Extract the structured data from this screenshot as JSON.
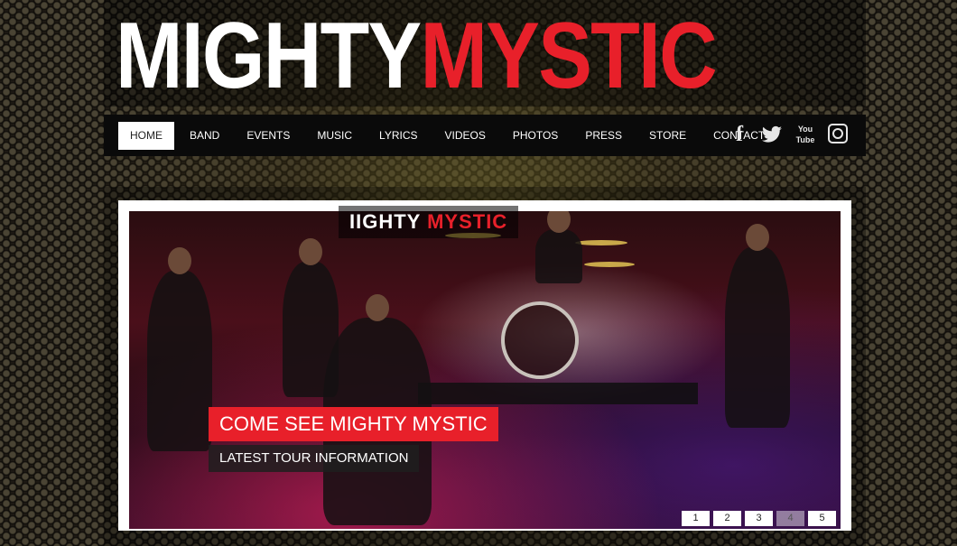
{
  "logo": {
    "part1": "MIGHTY",
    "part2": "MYSTIC"
  },
  "nav": {
    "items": [
      {
        "label": "HOME",
        "active": true
      },
      {
        "label": "BAND"
      },
      {
        "label": "EVENTS"
      },
      {
        "label": "MUSIC"
      },
      {
        "label": "LYRICS"
      },
      {
        "label": "VIDEOS"
      },
      {
        "label": "PHOTOS"
      },
      {
        "label": "PRESS"
      },
      {
        "label": "STORE"
      },
      {
        "label": "CONTACT"
      }
    ]
  },
  "social": {
    "facebook": "f",
    "youtube_top": "You",
    "youtube_bottom": "Tube",
    "icons": [
      "facebook-icon",
      "twitter-icon",
      "youtube-icon",
      "instagram-icon"
    ]
  },
  "slider": {
    "stage_banner_part1": "IIGHTY",
    "stage_banner_part2": "MYSTIC",
    "caption_title": "COME SEE MIGHTY MYSTIC",
    "caption_subtitle": "LATEST TOUR INFORMATION",
    "pages": [
      "1",
      "2",
      "3",
      "4",
      "5"
    ],
    "dim_page": "4"
  },
  "colors": {
    "accent_red": "#e8202a",
    "nav_bg": "#0a0a0a",
    "white": "#ffffff"
  }
}
